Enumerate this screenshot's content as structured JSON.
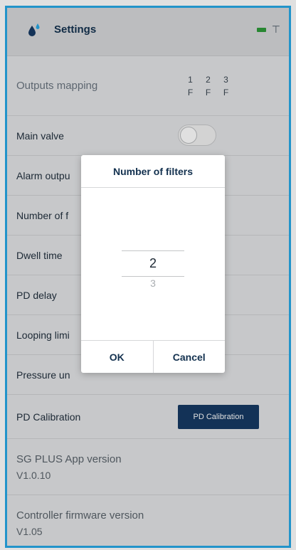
{
  "header": {
    "title": "Settings",
    "battery_color": "#2e9a39",
    "app_icon": "water-drops-icon"
  },
  "outputs": {
    "label": "Outputs mapping",
    "cells": [
      {
        "num": "1",
        "type": "F"
      },
      {
        "num": "2",
        "type": "F"
      },
      {
        "num": "3",
        "type": "F"
      }
    ]
  },
  "rows": {
    "main_valve": "Main valve",
    "alarm_output": "Alarm outpu",
    "number_of_filters": "Number of f",
    "dwell_time": "Dwell time",
    "pd_delay": "PD delay",
    "looping_limit": "Looping limi",
    "pressure_units": "Pressure un",
    "pd_calibration": "PD Calibration"
  },
  "main_valve_toggle": {
    "on": false
  },
  "pd_calibration_button": "PD Calibration",
  "app_version": {
    "label": "SG PLUS App version",
    "value": "V1.0.10"
  },
  "firmware_version": {
    "label": "Controller firmware version",
    "value": "V1.05"
  },
  "dialog": {
    "title": "Number of filters",
    "selected_value": "2",
    "next_value": "3",
    "ok_label": "OK",
    "cancel_label": "Cancel"
  },
  "colors": {
    "accent": "#27a9e6",
    "primary": "#163a63"
  }
}
